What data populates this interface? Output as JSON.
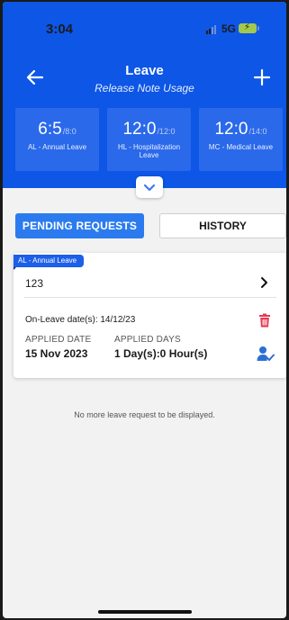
{
  "status_bar": {
    "time": "3:04",
    "network": "5G"
  },
  "header": {
    "title": "Leave",
    "subtitle": "Release Note Usage",
    "back_icon": "arrow-left-icon",
    "add_icon": "plus-icon"
  },
  "balances": [
    {
      "value": "6:5",
      "total": "/8:0",
      "label": "AL - Annual Leave"
    },
    {
      "value": "12:0",
      "total": "/12:0",
      "label": "HL - Hospitalization Leave"
    },
    {
      "value": "12:0",
      "total": "/14:0",
      "label": "MC - Medical Leave"
    }
  ],
  "tabs": {
    "pending": "PENDING REQUESTS",
    "history": "HISTORY",
    "active": "pending"
  },
  "request": {
    "type_tag": "AL - Annual Leave",
    "reference": "123",
    "on_leave_dates": "On-Leave date(s): 14/12/23",
    "applied_date_label": "APPLIED DATE",
    "applied_date": "15 Nov 2023",
    "applied_days_label": "APPLIED DAYS",
    "applied_days": "1 Day(s):0 Hour(s)"
  },
  "footer_message": "No more leave request to be displayed.",
  "colors": {
    "header_blue": "#0d56e6",
    "tile_blue": "#2a69ea",
    "tab_active": "#2b7bef",
    "tag_blue": "#1c5fe8",
    "delete_red": "#e8374f",
    "approver_blue": "#2b6fd6"
  }
}
